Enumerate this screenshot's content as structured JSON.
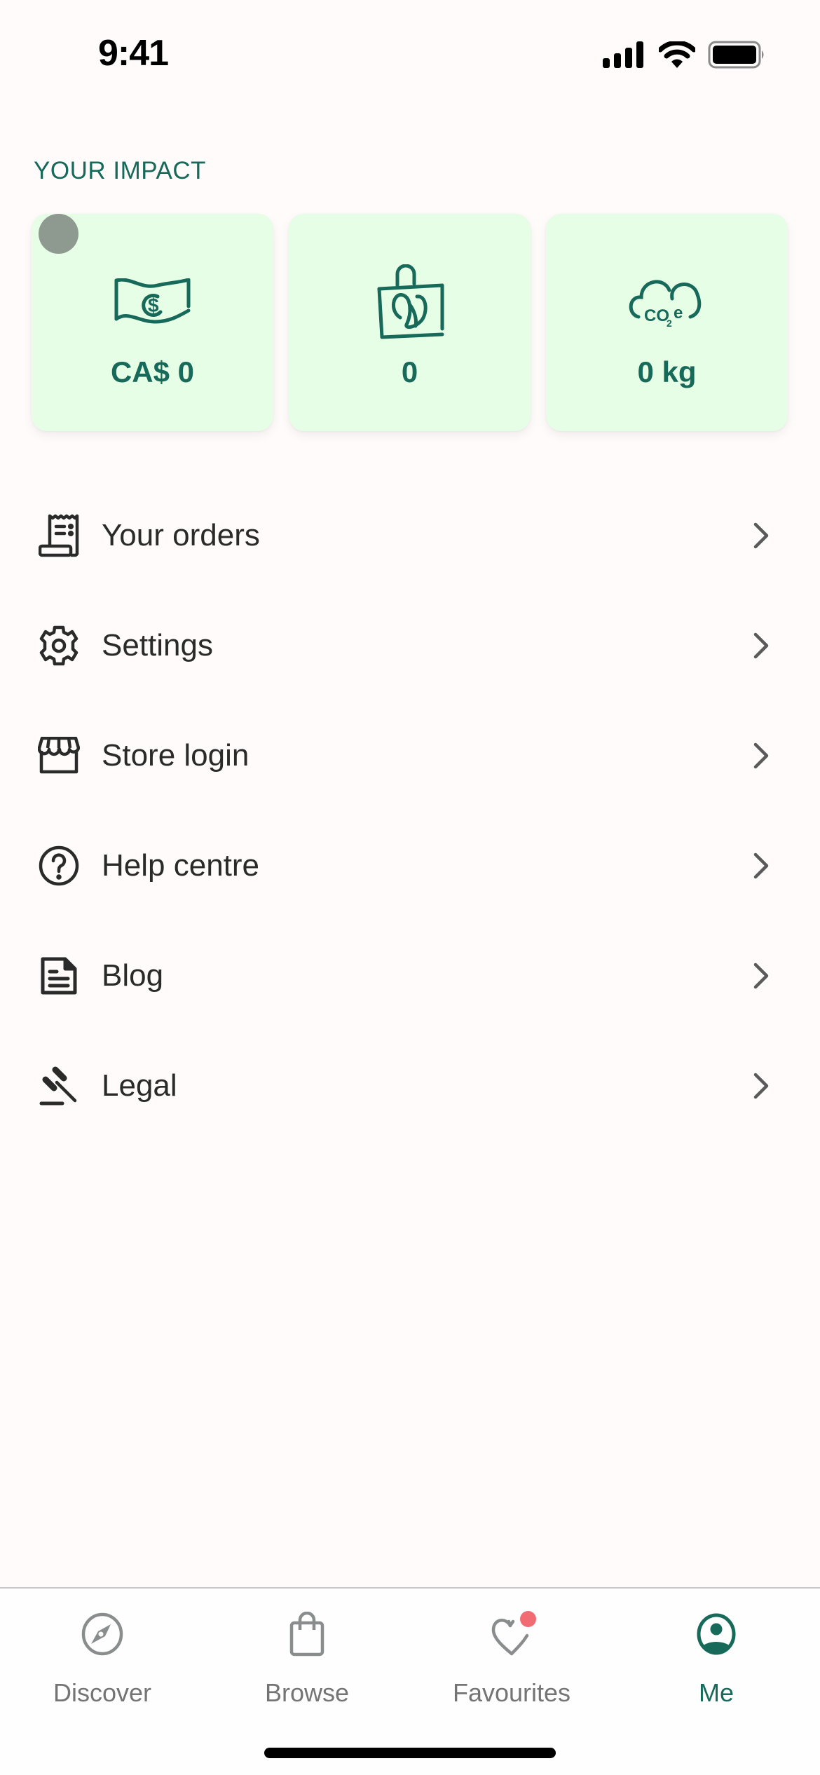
{
  "status_bar": {
    "time": "9:41",
    "icons": [
      "cellular-signal-icon",
      "wifi-icon",
      "battery-icon"
    ]
  },
  "impact": {
    "title": "YOUR IMPACT",
    "cards": [
      {
        "icon": "money-saved-icon",
        "value": "CA$ 0"
      },
      {
        "icon": "meal-bag-icon",
        "value": "0"
      },
      {
        "icon": "co2e-cloud-icon",
        "value": "0 kg"
      }
    ]
  },
  "menu": {
    "items": [
      {
        "icon": "receipt-icon",
        "label": "Your orders"
      },
      {
        "icon": "gear-icon",
        "label": "Settings"
      },
      {
        "icon": "storefront-icon",
        "label": "Store login"
      },
      {
        "icon": "help-circle-icon",
        "label": "Help centre"
      },
      {
        "icon": "document-icon",
        "label": "Blog"
      },
      {
        "icon": "gavel-icon",
        "label": "Legal"
      }
    ]
  },
  "tab_bar": {
    "tabs": [
      {
        "icon": "compass-icon",
        "label": "Discover",
        "active": false
      },
      {
        "icon": "shopping-bag-icon",
        "label": "Browse",
        "active": false
      },
      {
        "icon": "heart-icon",
        "label": "Favourites",
        "active": false,
        "badge": true
      },
      {
        "icon": "user-circle-icon",
        "label": "Me",
        "active": true
      }
    ]
  },
  "colors": {
    "brand_green": "#17695a",
    "card_background": "#e6fde6",
    "page_background": "#fefbfa",
    "badge_red": "#f06c72",
    "inactive_gray": "#747474"
  }
}
